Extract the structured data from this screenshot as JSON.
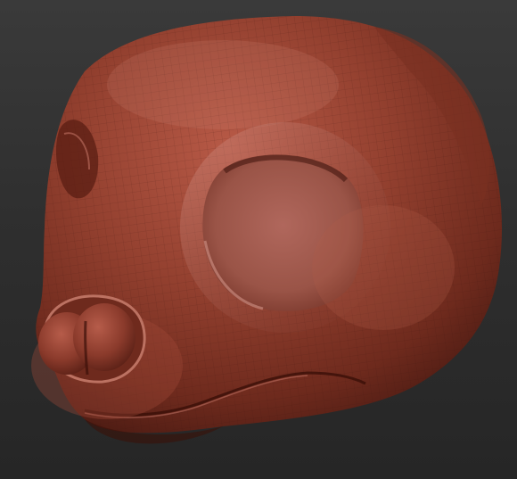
{
  "scene": {
    "background_top": "#3a3a3a",
    "background_bottom": "#262626",
    "material_color": "#8e3b2b",
    "material_highlight": "#c8766a",
    "material_shadow": "#4a1a12",
    "subject": "sculpted-head-icon"
  }
}
